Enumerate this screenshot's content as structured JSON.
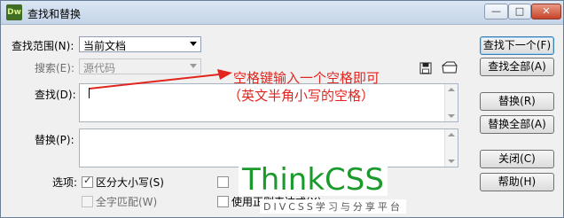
{
  "window": {
    "title": "查找和替换",
    "app_icon": "Dw"
  },
  "titlebar_buttons": {
    "minimize": "—",
    "maximize": "□",
    "close": "✕"
  },
  "scope": {
    "label": "查找范围(N):",
    "value": "当前文档"
  },
  "search_in": {
    "label": "搜索(E):",
    "value": "源代码"
  },
  "find": {
    "label": "查找(D):"
  },
  "replace": {
    "label": "替换(P):"
  },
  "annotation": {
    "line1": "空格键输入一个空格即可",
    "line2": "（英文半角小写的空格）"
  },
  "options": {
    "label": "选项:",
    "match_case": "区分大小写(S)",
    "whole_word": "全字匹配(W)",
    "regex": "使用正则表达式(X)"
  },
  "buttons": {
    "find_next": "查找下一个(F)",
    "find_all": "查找全部(A)",
    "replace": "替换(R)",
    "replace_all": "替换全部(A)",
    "close": "关闭(C)",
    "help": "帮助(H)"
  },
  "watermark": {
    "title": "ThinkCSS",
    "subtitle": "DIVCSS学习与分享平台"
  },
  "icons": {
    "save": "save-icon",
    "open": "open-icon",
    "arrow_color": "#e0261f"
  }
}
